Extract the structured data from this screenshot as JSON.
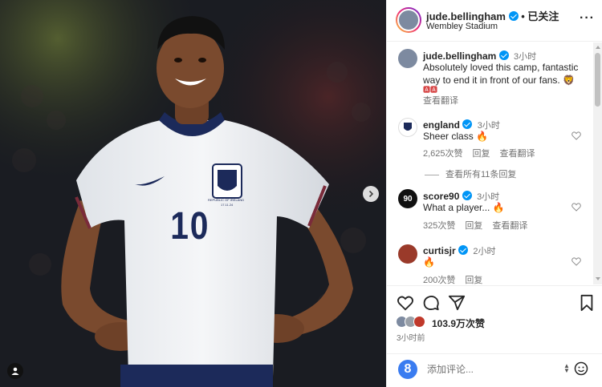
{
  "header": {
    "username": "jude.bellingham",
    "location": "Wembley Stadium",
    "follow_label": "已关注",
    "more_label": "···",
    "verified": true
  },
  "photo": {
    "jersey_number": "10",
    "crest_caption": "REPUBLIC OF IRELAND",
    "crest_date": "17.11.24"
  },
  "comments": [
    {
      "username": "jude.bellingham",
      "time": "3小时",
      "text": "Absolutely loved this camp, fantastic way to end it in front of our fans. 🦁",
      "extra_icons": "🅰🅰",
      "meta": [
        "查看翻译"
      ]
    },
    {
      "username": "england",
      "time": "3小时",
      "text": "Sheer class 🔥",
      "meta": [
        "2,625次赞",
        "回复",
        "查看翻译"
      ],
      "view_replies": "查看所有11条回复"
    },
    {
      "username": "score90",
      "time": "3小时",
      "text": "What a player... 🔥",
      "meta": [
        "325次赞",
        "回复",
        "查看翻译"
      ],
      "avatar_text": "90"
    },
    {
      "username": "curtisjr",
      "time": "2小时",
      "text": "🔥",
      "meta": [
        "200次赞",
        "回复"
      ]
    }
  ],
  "post": {
    "likes": "103.9万次赞",
    "time_ago": "3小时前",
    "comment_placeholder": "添加评论..."
  },
  "colors": {
    "verified": "#0095f6",
    "link_blue": "#0095f6",
    "muted": "#737373"
  }
}
